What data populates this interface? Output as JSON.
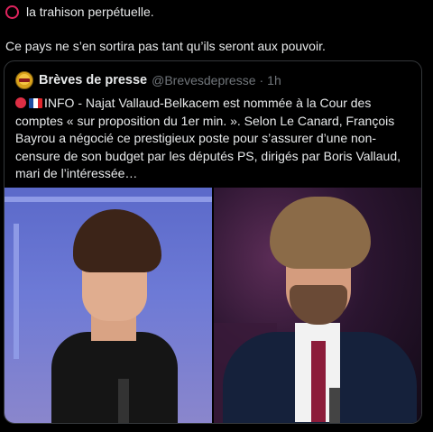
{
  "post": {
    "line1": "la trahison perpétuelle.",
    "line2": "Ce pays ne s’en sortira pas tant qu’ils seront aux pouvoir."
  },
  "quote": {
    "name": "Brèves de presse",
    "handle": "@Brevesdepresse",
    "dot": "·",
    "time": "1h",
    "text": "INFO - Najat Vallaud-Belkacem est nommée à la Cour des comptes « sur proposition du 1er min. ». Selon Le Canard, François Bayrou a négocié ce prestigieux poste pour s’assurer d’une non-censure de son budget par les députés PS, dirigés par Boris Vallaud, mari de l’intéressée…"
  },
  "colors": {
    "background": "#000000",
    "text": "#e7e9ea",
    "muted": "#71767b",
    "border": "#333639",
    "ring": "#e0245e"
  },
  "icons": [
    "red-circle-ring-icon",
    "red-dot-icon",
    "france-flag-icon",
    "avatar"
  ]
}
